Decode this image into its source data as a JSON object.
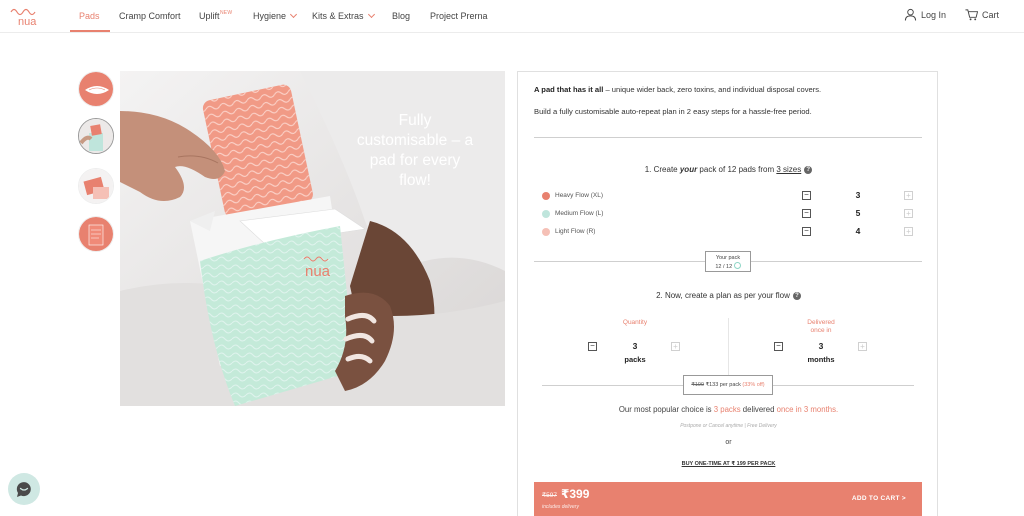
{
  "nav": {
    "items": [
      {
        "label": "Pads"
      },
      {
        "label": "Cramp Comfort"
      },
      {
        "label": "Uplift",
        "badge": "NEW"
      },
      {
        "label": "Hygiene"
      },
      {
        "label": "Kits & Extras"
      },
      {
        "label": "Blog"
      },
      {
        "label": "Project Prerna"
      }
    ],
    "login": "Log In",
    "cart": "Cart"
  },
  "hero": {
    "headline": "Fully customisable – a pad for every flow!"
  },
  "panel": {
    "intro_bold": "A pad that has it all",
    "intro_rest": " – unique wider back, zero toxins, and individual disposal covers.",
    "intro2": "Build a fully customisable auto-repeat plan in 2 easy steps for a hassle-free period.",
    "step1": {
      "prefix": "1. Create ",
      "emph": "your",
      "middle": " pack of 12 pads from ",
      "link": "3 sizes"
    },
    "flows": [
      {
        "name": "Heavy Flow (XL)",
        "qty": "3",
        "color": "#e8816f"
      },
      {
        "name": "Medium Flow (L)",
        "qty": "5",
        "color": "#bfe5dc"
      },
      {
        "name": "Light Flow (R)",
        "qty": "4",
        "color": "#f5c0b6"
      }
    ],
    "pack": {
      "label": "Your pack",
      "count": "12 / 12"
    },
    "step2": "2. Now, create a plan as per your flow",
    "quantity": {
      "label": "Quantity",
      "value": "3",
      "unit": "packs"
    },
    "delivered": {
      "label1": "Delivered",
      "label2": "once in",
      "value": "3",
      "unit": "months"
    },
    "price": {
      "old": "₹199",
      "per": "₹133 per pack",
      "off": "(33% off)"
    },
    "popular": {
      "prefix": "Our most popular choice is ",
      "hl1": "3 packs",
      "middle": " delivered ",
      "hl2": "once in 3 months."
    },
    "postpone": "Postpone or Cancel anytime | Free Delivery",
    "or": "or",
    "buy_one": "BUY ONE-TIME AT ₹ 199 PER PACK",
    "cart": {
      "old_price": "₹597",
      "new_price": "₹399",
      "sub": "includes delivery",
      "button": "ADD TO CART >"
    }
  },
  "colors": {
    "accent": "#e8816f",
    "mint": "#bfe5dc"
  }
}
